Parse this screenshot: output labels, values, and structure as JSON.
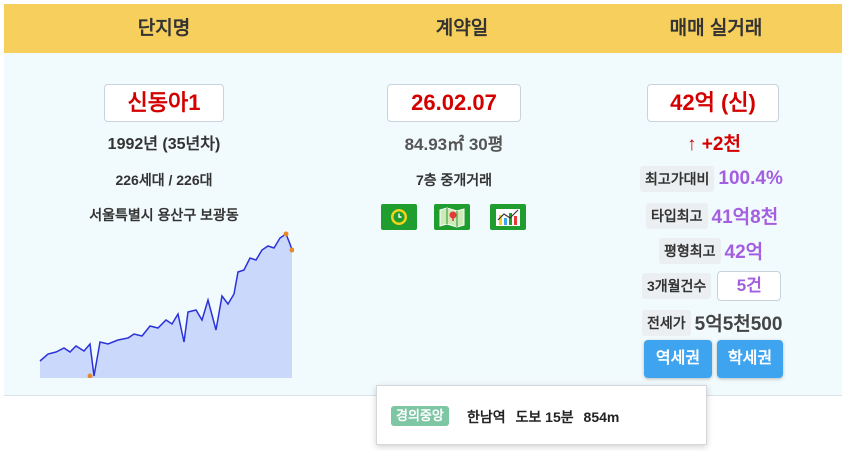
{
  "header": {
    "col_complex": "단지명",
    "col_contract_date": "계약일",
    "col_trade": "매매 실거래"
  },
  "complex": {
    "name": "신동아1",
    "year": "1992년 (35년차)",
    "households": "226세대 / 226대",
    "address": "서울특별시 용산구 보광동"
  },
  "contract": {
    "date": "26.02.07",
    "area": "84.93㎡ 30평",
    "floor": "7층 중개거래",
    "icons": [
      "clock-icon",
      "map-icon",
      "chart-icon"
    ]
  },
  "trade": {
    "price": "42억 (신)",
    "change": "↑ +2천",
    "max_ratio_label": "최고가대비",
    "max_ratio_value": "100.4%",
    "type_max_label": "타입최고",
    "type_max_value": "41억8천",
    "pyeong_max_label": "평형최고",
    "pyeong_max_value": "42억",
    "count_3m_label": "3개월건수",
    "count_3m_value": "5건",
    "jeonse_label": "전세가",
    "jeonse_value": "5억5천500",
    "station_button": "역세권",
    "school_button": "학세권"
  },
  "tooltip": {
    "line": "경의중앙",
    "station": "한남역",
    "walk": "도보 15분",
    "distance": "854m"
  },
  "colors": {
    "header_bg": "#f6cf5c",
    "price_red": "#d40000",
    "stat_purple": "#a45fe0",
    "button_blue": "#3ea4ef",
    "line_green": "#7fc6a4",
    "spark_line": "#2b32d8",
    "spark_fill": "#c9d8fb"
  }
}
